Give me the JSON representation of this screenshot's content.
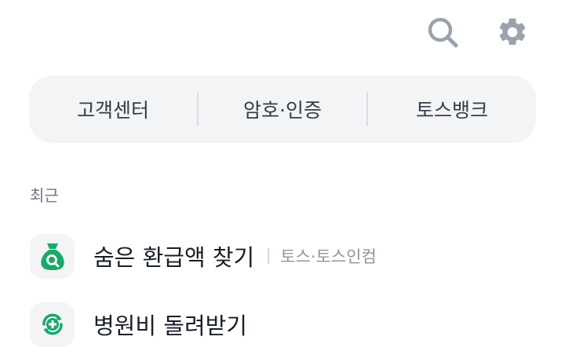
{
  "icons": {
    "search": "search-icon",
    "settings": "gear-icon"
  },
  "quick_menu": {
    "items": [
      {
        "label": "고객센터"
      },
      {
        "label": "암호·인증"
      },
      {
        "label": "토스뱅크"
      }
    ]
  },
  "recent": {
    "title": "최근",
    "items": [
      {
        "title": "숨은 환급액 찾기",
        "subtitle": "토스·토스인컴",
        "icon": "money-bag-search-icon"
      },
      {
        "title": "병원비 돌려받기",
        "subtitle": "",
        "icon": "medical-refund-icon"
      }
    ]
  },
  "colors": {
    "accent_green": "#1aa86b",
    "icon_gray": "#9aa3ad",
    "menu_bg": "#f2f4f6"
  }
}
